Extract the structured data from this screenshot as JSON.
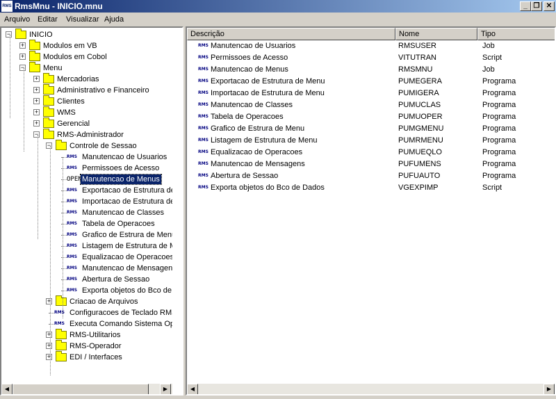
{
  "window": {
    "title": "RmsMnu - INICIO.mnu",
    "app_icon": "RMS",
    "minimize": "_",
    "maximize": "❐",
    "close": "✕"
  },
  "menu": [
    "Arquivo",
    "Editar",
    "Visualizar",
    "Ajuda"
  ],
  "tree": [
    {
      "label": "INICIO",
      "level": 0,
      "icon": "folder-icon",
      "expander": "minus"
    },
    {
      "label": "Modulos em VB",
      "level": 1,
      "icon": "folder-icon",
      "expander": "plus"
    },
    {
      "label": "Modulos em Cobol",
      "level": 1,
      "icon": "folder-icon",
      "expander": "plus"
    },
    {
      "label": "Menu",
      "level": 1,
      "icon": "folder-icon",
      "expander": "minus"
    },
    {
      "label": "Mercadorias",
      "level": 2,
      "icon": "folder-icon",
      "expander": "plus"
    },
    {
      "label": "Administrativo e Financeiro",
      "level": 2,
      "icon": "folder-icon",
      "expander": "plus"
    },
    {
      "label": "Clientes",
      "level": 2,
      "icon": "folder-icon",
      "expander": "plus"
    },
    {
      "label": "WMS",
      "level": 2,
      "icon": "folder-icon",
      "expander": "plus"
    },
    {
      "label": "Gerencial",
      "level": 2,
      "icon": "folder-icon",
      "expander": "plus"
    },
    {
      "label": "RMS-Administrador",
      "level": 2,
      "icon": "folder-icon",
      "expander": "minus"
    },
    {
      "label": "Controle de Sessao",
      "level": 3,
      "icon": "folder-icon",
      "expander": "minus"
    },
    {
      "label": "Manutencao de Usuarios",
      "level": 4,
      "icon": "rms-icon"
    },
    {
      "label": "Permissoes de Acesso",
      "level": 4,
      "icon": "rms-icon"
    },
    {
      "label": "Manutencao de Menus",
      "level": 4,
      "icon": "open-icon",
      "selected": true
    },
    {
      "label": "Exportacao de Estrutura de M",
      "level": 4,
      "icon": "rms-icon"
    },
    {
      "label": "Importacao de Estrutura de M",
      "level": 4,
      "icon": "rms-icon"
    },
    {
      "label": "Manutencao de Classes",
      "level": 4,
      "icon": "rms-icon"
    },
    {
      "label": "Tabela de Operacoes",
      "level": 4,
      "icon": "rms-icon"
    },
    {
      "label": "Grafico de Estrura de Menu",
      "level": 4,
      "icon": "rms-icon"
    },
    {
      "label": "Listagem de Estrutura de Men",
      "level": 4,
      "icon": "rms-icon"
    },
    {
      "label": "Equalizacao de Operacoes",
      "level": 4,
      "icon": "rms-icon"
    },
    {
      "label": "Manutencao de Mensagens",
      "level": 4,
      "icon": "rms-icon"
    },
    {
      "label": "Abertura de Sessao",
      "level": 4,
      "icon": "rms-icon"
    },
    {
      "label": "Exporta objetos do Bco de Da",
      "level": 4,
      "icon": "rms-icon"
    },
    {
      "label": "Criacao de Arquivos",
      "level": 3,
      "icon": "folder-icon",
      "expander": "plus"
    },
    {
      "label": "Configuracoes de Teclado RMS",
      "level": 3,
      "icon": "rms-icon"
    },
    {
      "label": "Executa Comando Sistema Operac",
      "level": 3,
      "icon": "rms-icon"
    },
    {
      "label": "RMS-Utilitarios",
      "level": 3,
      "icon": "folder-icon",
      "expander": "plus"
    },
    {
      "label": "RMS-Operador",
      "level": 3,
      "icon": "folder-icon",
      "expander": "plus"
    },
    {
      "label": "EDI / Interfaces",
      "level": 3,
      "icon": "folder-icon",
      "expander": "plus"
    }
  ],
  "list": {
    "columns": [
      "Descrição",
      "Nome",
      "Tipo"
    ],
    "rows": [
      {
        "desc": "Manutencao de Usuarios",
        "name": "RMSUSER",
        "type": "Job"
      },
      {
        "desc": "Permissoes de Acesso",
        "name": "VITUTRAN",
        "type": "Script"
      },
      {
        "desc": "Manutencao de Menus",
        "name": "RMSMNU",
        "type": "Job"
      },
      {
        "desc": "Exportacao de Estrutura de Menu",
        "name": "PUMEGERA",
        "type": "Programa"
      },
      {
        "desc": "Importacao de Estrutura de Menu",
        "name": "PUMIGERA",
        "type": "Programa"
      },
      {
        "desc": "Manutencao de Classes",
        "name": "PUMUCLAS",
        "type": "Programa"
      },
      {
        "desc": "Tabela de Operacoes",
        "name": "PUMUOPER",
        "type": "Programa"
      },
      {
        "desc": "Grafico de Estrura de Menu",
        "name": "PUMGMENU",
        "type": "Programa"
      },
      {
        "desc": "Listagem de Estrutura de Menu",
        "name": "PUMRMENU",
        "type": "Programa"
      },
      {
        "desc": "Equalizacao de Operacoes",
        "name": "PUMUEQLO",
        "type": "Programa"
      },
      {
        "desc": "Manutencao de Mensagens",
        "name": "PUFUMENS",
        "type": "Programa"
      },
      {
        "desc": "Abertura de Sessao",
        "name": "PUFUAUTO",
        "type": "Programa"
      },
      {
        "desc": "Exporta objetos do Bco de Dados",
        "name": "VGEXPIMP",
        "type": "Script"
      }
    ]
  },
  "icons": {
    "rms": "RMS",
    "open": "OPEN",
    "plus": "+",
    "minus": "−",
    "scroll_left": "◀",
    "scroll_right": "▶",
    "scroll_up": "▲",
    "scroll_down": "▼"
  }
}
